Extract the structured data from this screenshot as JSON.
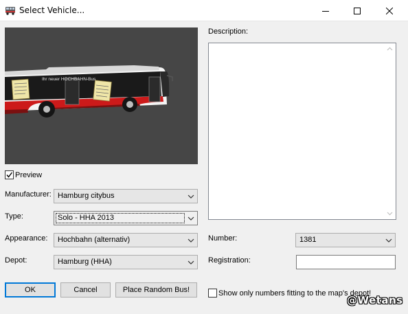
{
  "window": {
    "title": "Select Vehicle...",
    "icons": {
      "app": "bus-icon",
      "minimize": "minimize-icon",
      "maximize": "maximize-icon",
      "close": "close-icon"
    }
  },
  "preview": {
    "checkbox_label": "Preview",
    "checked": true,
    "bus_line_text": "Ihr neuer HOCHBAHN-Bus"
  },
  "fields": {
    "manufacturer": {
      "label": "Manufacturer:",
      "value": "Hamburg citybus"
    },
    "type": {
      "label": "Type:",
      "value": "Solo - HHA 2013"
    },
    "appearance": {
      "label": "Appearance:",
      "value": "Hochbahn (alternativ)"
    },
    "depot": {
      "label": "Depot:",
      "value": "Hamburg (HHA)"
    }
  },
  "description": {
    "label": "Description:",
    "text": ""
  },
  "number": {
    "label": "Number:",
    "value": "1381"
  },
  "registration": {
    "label": "Registration:",
    "value": ""
  },
  "filter": {
    "label": "Show only numbers fitting to the map's depot!",
    "checked": false
  },
  "buttons": {
    "ok": "OK",
    "cancel": "Cancel",
    "random": "Place Random Bus!"
  },
  "watermark": "@Wetans",
  "colors": {
    "accent": "#0078d7",
    "bus_red": "#cc1a1a",
    "preview_bg": "#464646"
  }
}
